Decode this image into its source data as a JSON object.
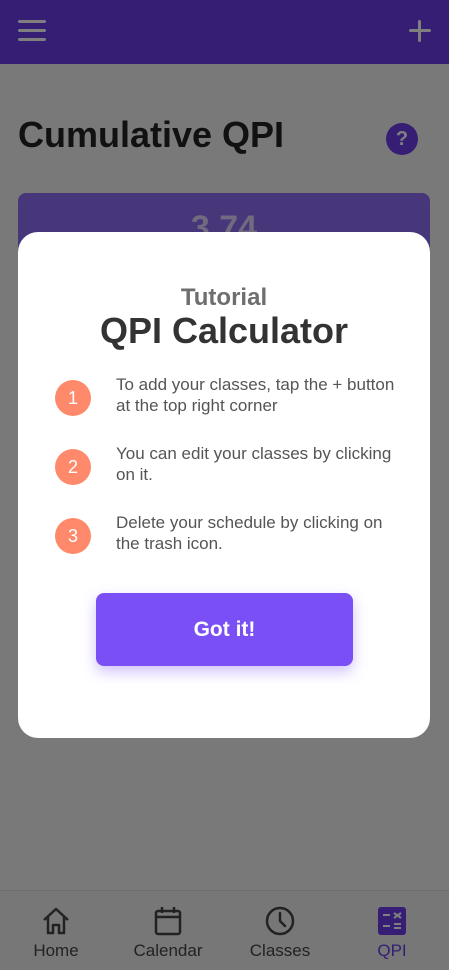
{
  "header": {
    "menu_icon": "hamburger-menu-icon",
    "add_icon": "plus-icon"
  },
  "page": {
    "title": "Cumulative QPI",
    "help_label": "?",
    "qpi_value": "3.74"
  },
  "tutorial": {
    "subtitle": "Tutorial",
    "title": "QPI Calculator",
    "steps": [
      {
        "number": "1",
        "text": "To add your classes, tap the + button at the top right corner"
      },
      {
        "number": "2",
        "text": "You can edit your classes by clicking on it."
      },
      {
        "number": "3",
        "text": "Delete your schedule by clicking on the trash icon."
      }
    ],
    "button_label": "Got it!"
  },
  "bottom_nav": {
    "items": [
      {
        "label": "Home",
        "icon": "home-icon"
      },
      {
        "label": "Calendar",
        "icon": "calendar-icon"
      },
      {
        "label": "Classes",
        "icon": "clock-icon"
      },
      {
        "label": "QPI",
        "icon": "calculator-icon"
      }
    ],
    "active": "QPI"
  },
  "colors": {
    "primary": "#6a3de8",
    "step_badge": "#ff8a6b",
    "button": "#7a4ff5"
  }
}
